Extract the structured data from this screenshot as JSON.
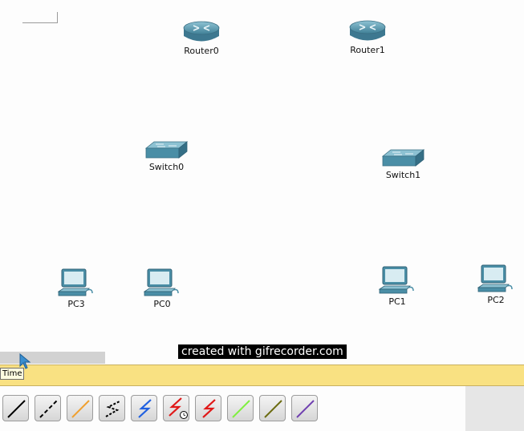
{
  "devices": {
    "router0": "Router0",
    "router1": "Router1",
    "switch0": "Switch0",
    "switch1": "Switch1",
    "pc3": "PC3",
    "pc0": "PC0",
    "pc1": "PC1",
    "pc2": "PC2"
  },
  "watermark": "created with gifrecorder.com",
  "time_tooltip": "Time",
  "connection_tools": [
    "console-cable-icon",
    "straight-through-cable-icon",
    "crossover-cable-icon",
    "rollover-cable-icon",
    "serial-dce-cable-icon",
    "serial-dce-clock-cable-icon",
    "serial-dte-cable-icon",
    "fiber-cable-icon",
    "phone-cable-icon",
    "coaxial-cable-icon"
  ],
  "colors": {
    "device_teal": "#4a8ea6",
    "timebar": "#f9e182"
  }
}
